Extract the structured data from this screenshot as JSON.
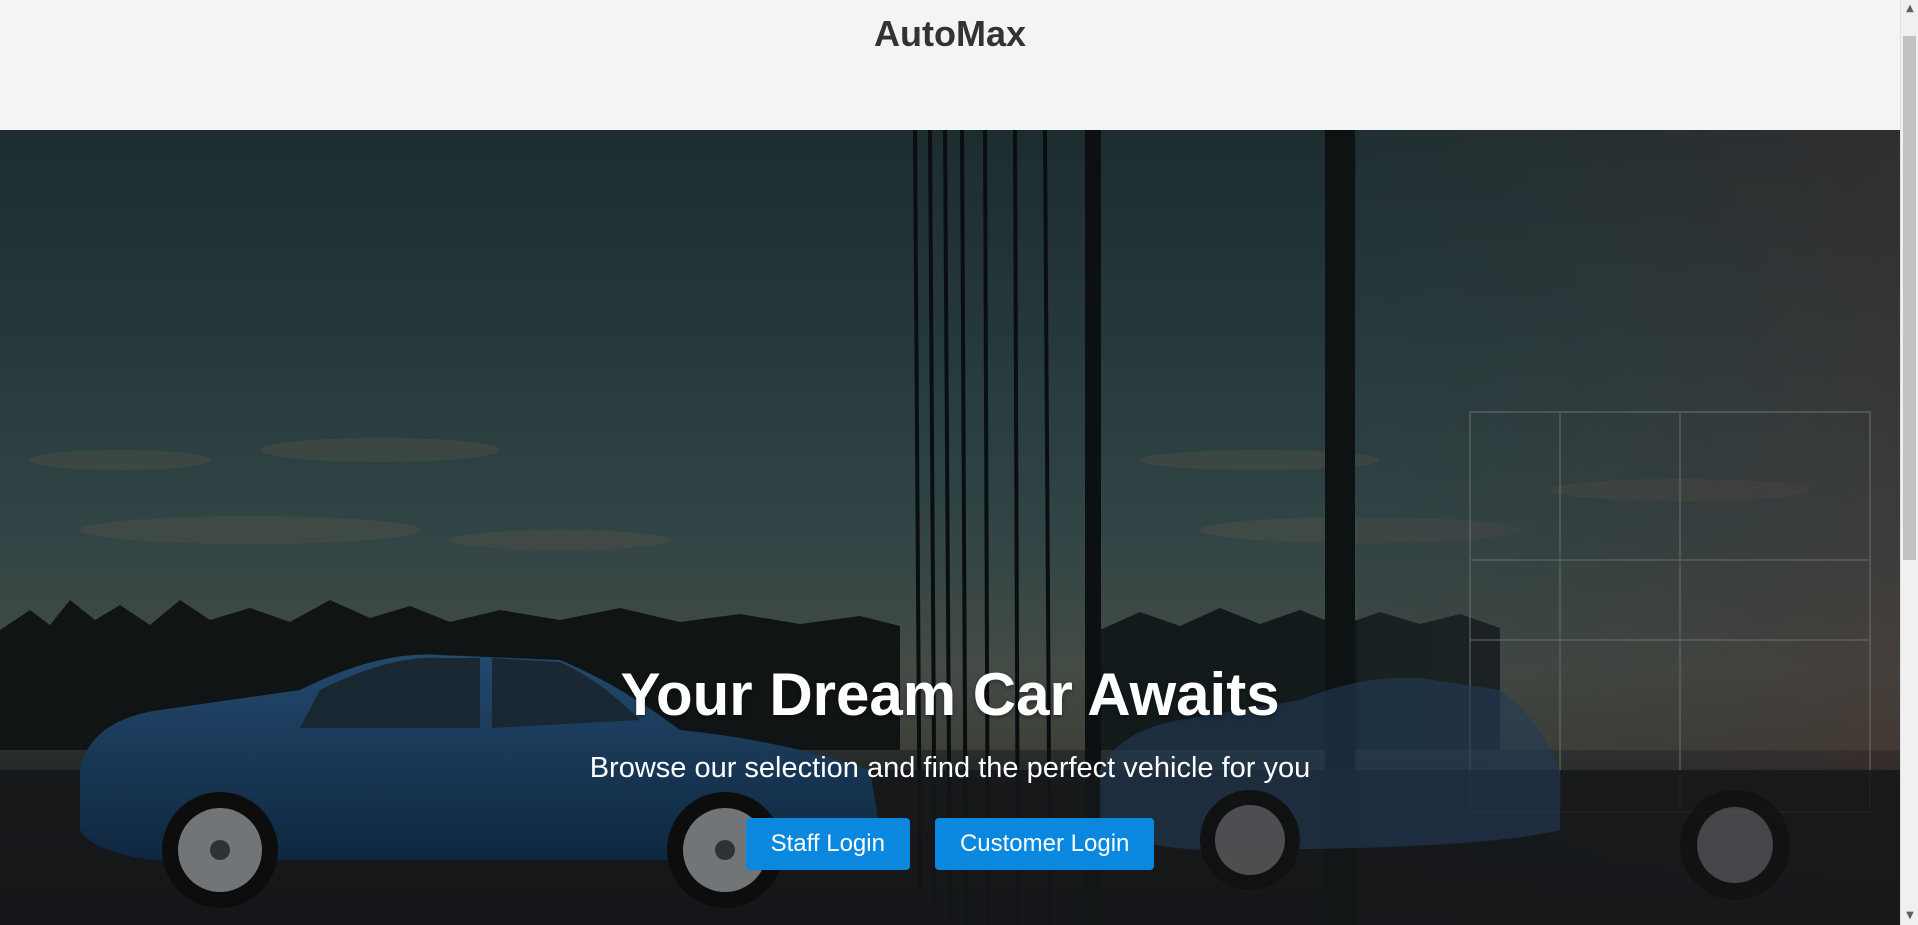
{
  "header": {
    "brand": "AutoMax"
  },
  "hero": {
    "title": "Your Dream Car Awaits",
    "subtitle": "Browse our selection and find the perfect vehicle for you",
    "buttons": {
      "staff_login": "Staff Login",
      "customer_login": "Customer Login"
    },
    "background_image": "dusk car dealership with blue sedan and glass building reflection"
  },
  "colors": {
    "header_bg": "#f4f4f4",
    "brand_text": "#333333",
    "button_bg": "#0a88e0",
    "button_text": "#ffffff",
    "hero_text": "#ffffff"
  },
  "scrollbar": {
    "up_arrow": "▲",
    "down_arrow": "▼"
  }
}
